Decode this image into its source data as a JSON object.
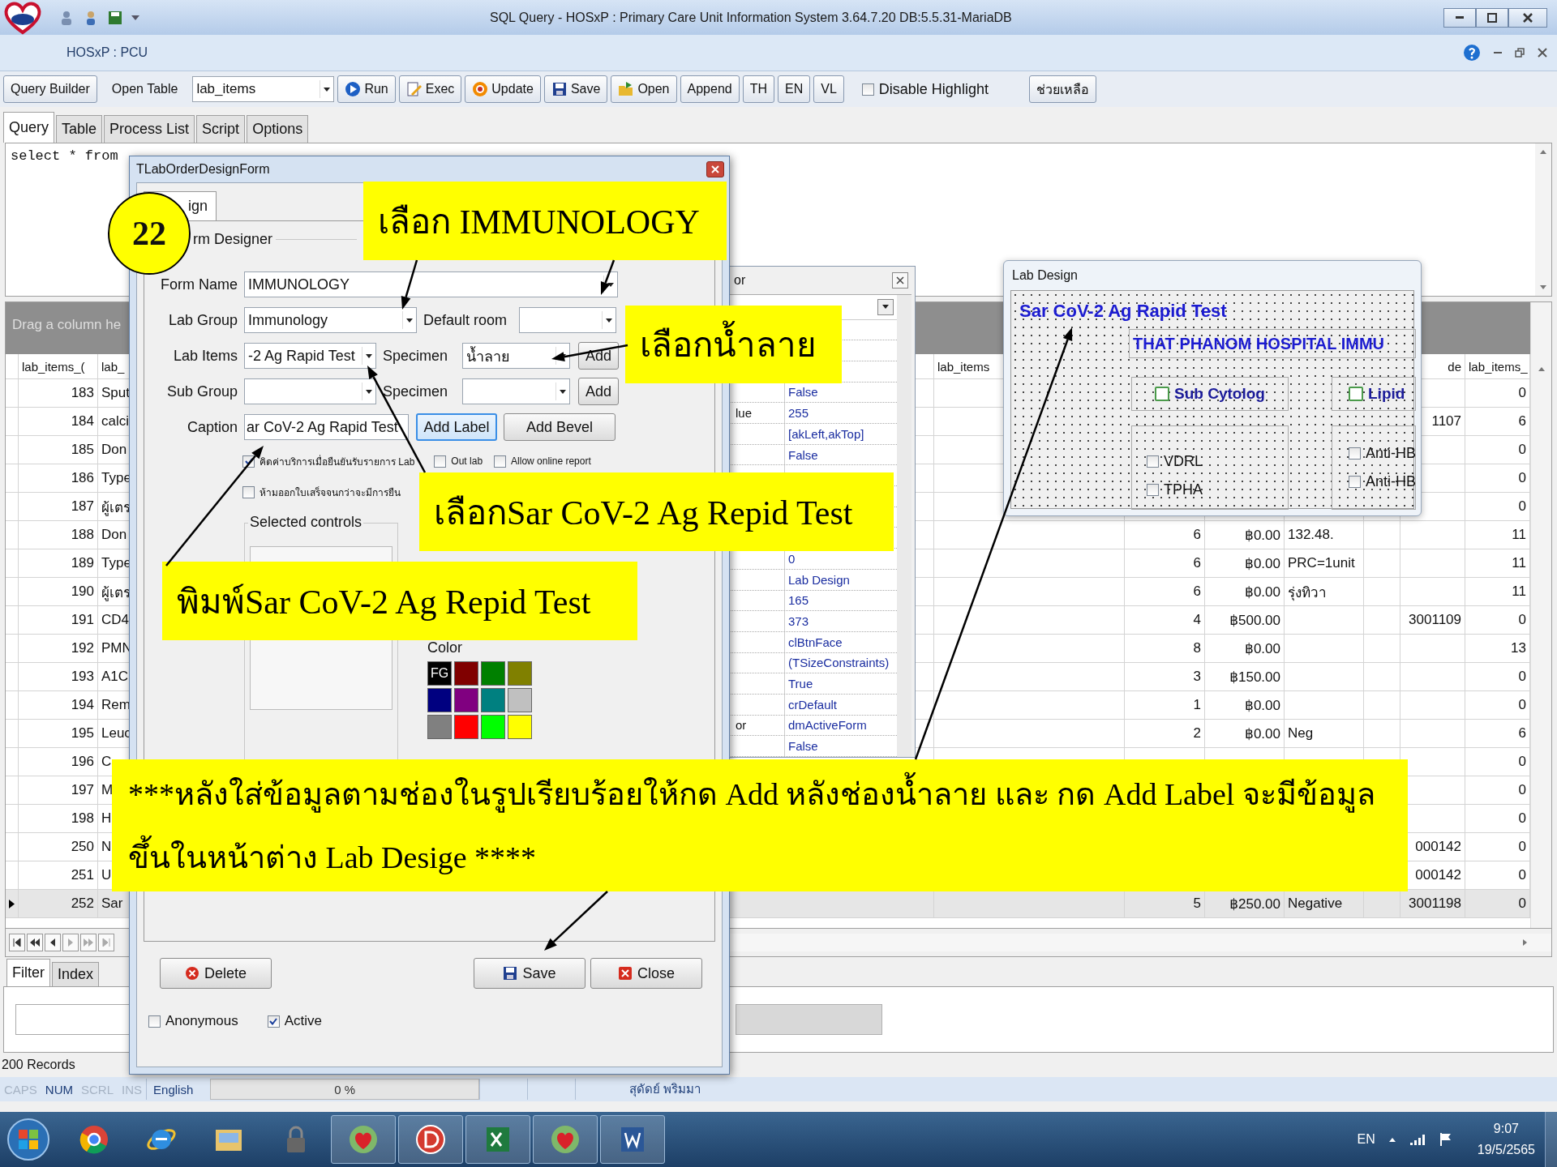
{
  "window": {
    "title": "SQL Query -  HOSxP : Primary Care Unit Information System 3.64.7.20 DB:5.5.31-MariaDB",
    "subtitle": "HOSxP : PCU"
  },
  "toolbar": [
    {
      "kind": "button",
      "label": "Query Builder"
    },
    {
      "kind": "label",
      "label": "Open Table"
    },
    {
      "kind": "combo",
      "value": "lab_items"
    },
    {
      "kind": "icon_button",
      "label": "Run"
    },
    {
      "kind": "icon_button",
      "label": "Exec"
    },
    {
      "kind": "icon_button",
      "label": "Update"
    },
    {
      "kind": "icon_button",
      "label": "Save"
    },
    {
      "kind": "icon_button",
      "label": "Open"
    },
    {
      "kind": "button",
      "label": "Append"
    },
    {
      "kind": "button",
      "label": "TH"
    },
    {
      "kind": "button",
      "label": "EN"
    },
    {
      "kind": "button",
      "label": "VL"
    },
    {
      "kind": "checkbox",
      "label": "Disable Highlight",
      "checked": false
    },
    {
      "kind": "button",
      "label": "ช่วยเหลือ"
    }
  ],
  "tabs": [
    {
      "label": "Query",
      "selected": true
    },
    {
      "label": "Table",
      "selected": false
    },
    {
      "label": "Process List",
      "selected": false
    },
    {
      "label": "Script",
      "selected": false
    },
    {
      "label": "Options",
      "selected": false
    }
  ],
  "editor": {
    "text": "select * from"
  },
  "grid": {
    "group_panel": "Drag a column he",
    "columns": [
      {
        "header": "lab_items_("
      },
      {
        "header": "lab_"
      },
      {
        "header": "lab_items"
      },
      {},
      {},
      {},
      {},
      {
        "header": "de"
      },
      {
        "header": "lab_items_"
      }
    ],
    "rows": [
      {
        "selected": false,
        "cells": [
          "183",
          "Sput",
          null,
          null,
          null,
          null,
          null,
          null,
          "0"
        ]
      },
      {
        "selected": false,
        "cells": [
          "184",
          "calci",
          null,
          null,
          null,
          null,
          null,
          "1107",
          "6"
        ]
      },
      {
        "selected": false,
        "cells": [
          "185",
          "Don",
          null,
          null,
          null,
          null,
          null,
          null,
          "0"
        ]
      },
      {
        "selected": false,
        "cells": [
          "186",
          "Type",
          null,
          null,
          null,
          null,
          null,
          null,
          "0"
        ]
      },
      {
        "selected": false,
        "cells": [
          "187",
          "ผู้เตร",
          null,
          null,
          null,
          null,
          null,
          null,
          "0"
        ]
      },
      {
        "selected": false,
        "cells": [
          "188",
          "Don",
          null,
          "6",
          "฿0.00",
          "132.48.",
          null,
          null,
          "11"
        ]
      },
      {
        "selected": false,
        "cells": [
          "189",
          "Type",
          null,
          "6",
          "฿0.00",
          "PRC=1unit",
          null,
          null,
          "11"
        ]
      },
      {
        "selected": false,
        "cells": [
          "190",
          "ผู้เตร",
          null,
          "6",
          "฿0.00",
          "รุ่งทิวา",
          null,
          null,
          "11"
        ]
      },
      {
        "selected": false,
        "cells": [
          "191",
          "CD4",
          null,
          "4",
          "฿500.00",
          null,
          null,
          "3001109",
          "0"
        ]
      },
      {
        "selected": false,
        "cells": [
          "192",
          "PMN",
          null,
          "8",
          "฿0.00",
          null,
          null,
          null,
          "13"
        ]
      },
      {
        "selected": false,
        "cells": [
          "193",
          "A1C",
          null,
          "3",
          "฿150.00",
          null,
          null,
          null,
          "0"
        ]
      },
      {
        "selected": false,
        "cells": [
          "194",
          "Rem",
          null,
          "1",
          "฿0.00",
          null,
          null,
          null,
          "0"
        ]
      },
      {
        "selected": false,
        "cells": [
          "195",
          "Leuc",
          null,
          "2",
          "฿0.00",
          "Neg",
          null,
          null,
          "6"
        ]
      },
      {
        "selected": false,
        "cells": [
          "196",
          "C",
          null,
          null,
          null,
          null,
          null,
          null,
          "0"
        ]
      },
      {
        "selected": false,
        "cells": [
          "197",
          "M",
          null,
          null,
          null,
          null,
          null,
          null,
          "0"
        ]
      },
      {
        "selected": false,
        "cells": [
          "198",
          "H",
          null,
          null,
          null,
          null,
          null,
          null,
          "0"
        ]
      },
      {
        "selected": false,
        "cells": [
          "250",
          "N",
          null,
          null,
          null,
          null,
          null,
          "000142",
          "0"
        ]
      },
      {
        "selected": false,
        "cells": [
          "251",
          "U",
          null,
          null,
          null,
          null,
          null,
          "000142",
          "0"
        ]
      },
      {
        "selected": true,
        "cells": [
          "252",
          "Sar",
          null,
          "5",
          "฿250.00",
          "Negative",
          null,
          "3001198",
          "0"
        ]
      }
    ]
  },
  "filter_tabs": [
    {
      "label": "Filter",
      "selected": true
    },
    {
      "label": "Index",
      "selected": false
    }
  ],
  "record_count": "200 Records",
  "status_bar": {
    "keys": [
      {
        "label": "CAPS",
        "on": false
      },
      {
        "label": "NUM",
        "on": true
      },
      {
        "label": "SCRL",
        "on": false
      },
      {
        "label": "INS",
        "on": false
      }
    ],
    "language": "English",
    "progress": {
      "level": 0,
      "reading": "0 %"
    },
    "user": "สุดัดย์ พริมมา"
  },
  "taskbar": {
    "apps": [
      {
        "running": false
      },
      {
        "running": false
      },
      {
        "running": false
      },
      {
        "running": false
      },
      {
        "running": true
      },
      {
        "running": true
      },
      {
        "running": true
      },
      {
        "running": true
      },
      {
        "running": true
      }
    ],
    "language": "EN",
    "time": "9:07",
    "date": "19/5/2565"
  },
  "dialog": {
    "title": "TLabOrderDesignForm",
    "tab": "ign",
    "group": "rm Designer",
    "form_name": {
      "label": "Form Name",
      "value": "IMMUNOLOGY"
    },
    "lab_group": {
      "label": "Lab Group",
      "value": "Immunology"
    },
    "default_room": {
      "label": "Default room"
    },
    "lab_items": {
      "label": "Lab Items",
      "value": "-2 Ag Rapid Test"
    },
    "specimen": {
      "label": "Specimen",
      "value": "น้ำลาย"
    },
    "add_specimen": "Add",
    "sub_group": {
      "label": "Sub Group"
    },
    "specimen_2": {
      "label": "Specimen"
    },
    "add_specimen_2": "Add",
    "caption": {
      "label": "Caption",
      "value": "ar CoV-2 Ag Rapid Test"
    },
    "add_label": {
      "label": "Add Label",
      "focused": true
    },
    "add_bevel": "Add Bevel",
    "options": [
      {
        "label": "คิดค่าบริการเมื่อยืนยันรับรายการ Lab",
        "checked": true
      },
      {
        "label": "Out lab",
        "checked": false
      },
      {
        "label": "Allow online report",
        "checked": false
      },
      {
        "label": "ห้ามออกใบเสร็จจนกว่าจะมีการยืน",
        "checked": false
      }
    ],
    "selected_controls": "Selected controls",
    "color_label": "Color",
    "swatches": [
      {
        "color": "#000000",
        "label": "FG"
      },
      {
        "color": "#800000"
      },
      {
        "color": "#008000"
      },
      {
        "color": "#808000"
      },
      {
        "color": "#000080"
      },
      {
        "color": "#800080"
      },
      {
        "color": "#008080"
      },
      {
        "color": "#c0c0c0"
      },
      {
        "color": "#808080"
      },
      {
        "color": "#ff0000"
      },
      {
        "color": "#00ff00"
      },
      {
        "color": "#ffff00"
      }
    ],
    "buttons": [
      {
        "label": "Delete"
      },
      {
        "label": "Save"
      },
      {
        "label": "Close"
      }
    ],
    "footer_checks": [
      {
        "label": "Anonymous",
        "checked": false
      },
      {
        "label": "Active",
        "checked": true
      }
    ]
  },
  "inspector": {
    "title": "or",
    "rows": [
      {},
      {},
      {},
      {
        "value": "False"
      },
      {
        "name": "lue",
        "value": "255"
      },
      {
        "value": "[akLeft,akTop]"
      },
      {
        "value": "False"
      },
      {},
      {},
      {},
      {},
      {
        "value": "0"
      },
      {
        "value": "Lab Design"
      },
      {
        "value": "165"
      },
      {
        "value": "373"
      },
      {
        "value": "clBtnFace"
      },
      {
        "value": "(TSizeConstraints)"
      },
      {
        "value": "True"
      },
      {
        "value": "crDefault"
      },
      {
        "name": "or",
        "value": "dmActiveForm"
      },
      {
        "value": "False"
      }
    ]
  },
  "lab_design": {
    "title": "Lab Design",
    "heading": "Sar CoV-2 Ag Rapid Test",
    "banner": "THAT PHANOM HOSPITAL IMMU",
    "groups": [
      {
        "label": "Sub Cytolog",
        "checked": false,
        "items": [
          {
            "label": "VDRL",
            "checked": false
          },
          {
            "label": "TPHA",
            "checked": false
          }
        ]
      },
      {
        "label": "Lipid",
        "checked": false,
        "items": [
          {
            "label": "Anti-HB",
            "checked": false
          },
          {
            "label": "Anti-HB",
            "checked": false
          }
        ]
      }
    ]
  },
  "annotations": {
    "step": "22",
    "callouts": [
      {
        "text": "เลือก IMMUNOLOGY"
      },
      {
        "text": "เลือกน้ำลาย"
      },
      {
        "text": "เลือกSar CoV-2 Ag Repid Test"
      },
      {
        "text": "พิมพ์Sar CoV-2 Ag Repid Test"
      },
      {
        "text": "***หลังใส่ข้อมูลตามช่องในรูปเรียบร้อยให้กด Add หลังช่องน้ำลาย และ กด Add Label จะมีข้อมูลขึ้นในหน้าต่าง Lab Desige ****"
      }
    ]
  }
}
